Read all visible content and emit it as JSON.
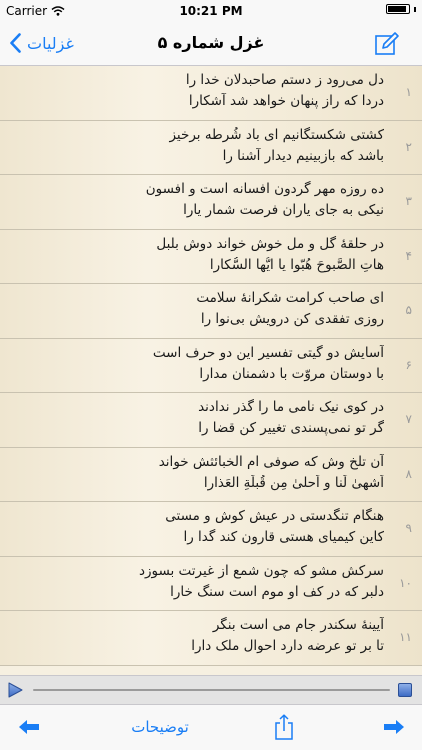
{
  "status": {
    "carrier": "Carrier",
    "time": "10:21 PM"
  },
  "nav": {
    "title": "غزل شماره ۵",
    "back_label": "غزلیات"
  },
  "verses": [
    {
      "num": "۱",
      "line1": "دل می‌رود ز دستم صاحبدلان خدا را",
      "line2": "دردا که راز پنهان خواهد شد آشکارا"
    },
    {
      "num": "۲",
      "line1": "کشتی شکستگانیم ای باد شُرطه برخیز",
      "line2": "باشد که بازبینیم دیدار آشنا را"
    },
    {
      "num": "۳",
      "line1": "ده روزه مهر گردون افسانه است و افسون",
      "line2": "نیکی به جای یاران فرصت شمار یارا"
    },
    {
      "num": "۴",
      "line1": "در حلقهٔ گل و مل خوش خواند دوش بلبل",
      "line2": "هاتِ الصَّبوحَ هُبّوا یا ایُّها السُّکارا"
    },
    {
      "num": "۵",
      "line1": "ای صاحب کرامت شکرانهٔ سلامت",
      "line2": "روزی تفقدی کن درویش بی‌نوا را"
    },
    {
      "num": "۶",
      "line1": "آسایش دو گیتی تفسیر این دو حرف است",
      "line2": "با دوستان مروّت با دشمنان مدارا"
    },
    {
      "num": "۷",
      "line1": "در کوی نیک نامی ما را گذر ندادند",
      "line2": "گر تو نمی‌پسندی تغییر کن قضا را"
    },
    {
      "num": "۸",
      "line1": "آن تلخ وش که صوفی ام الخبائثش خواند",
      "line2": "اَشهیٰ لَنا و اَحلیٰ مِن قُبلَةِ العَذارا"
    },
    {
      "num": "۹",
      "line1": "هنگام تنگدستی در عیش کوش و مستی",
      "line2": "کاین کیمیای هستی قارون کند گدا را"
    },
    {
      "num": "۱۰",
      "line1": "سرکش مشو که چون شمع از غیرتت بسوزد",
      "line2": "دلبر که در کف او موم است سنگ خارا"
    },
    {
      "num": "۱۱",
      "line1": "آیینهٔ سکندر جام می است بنگر",
      "line2": "تا بر تو عرضه دارد احوال ملک دارا"
    }
  ],
  "player": {
    "progress": 0.0
  },
  "toolbar": {
    "notes_label": "توضیحات"
  },
  "colors": {
    "accent": "#1a7ef5"
  }
}
